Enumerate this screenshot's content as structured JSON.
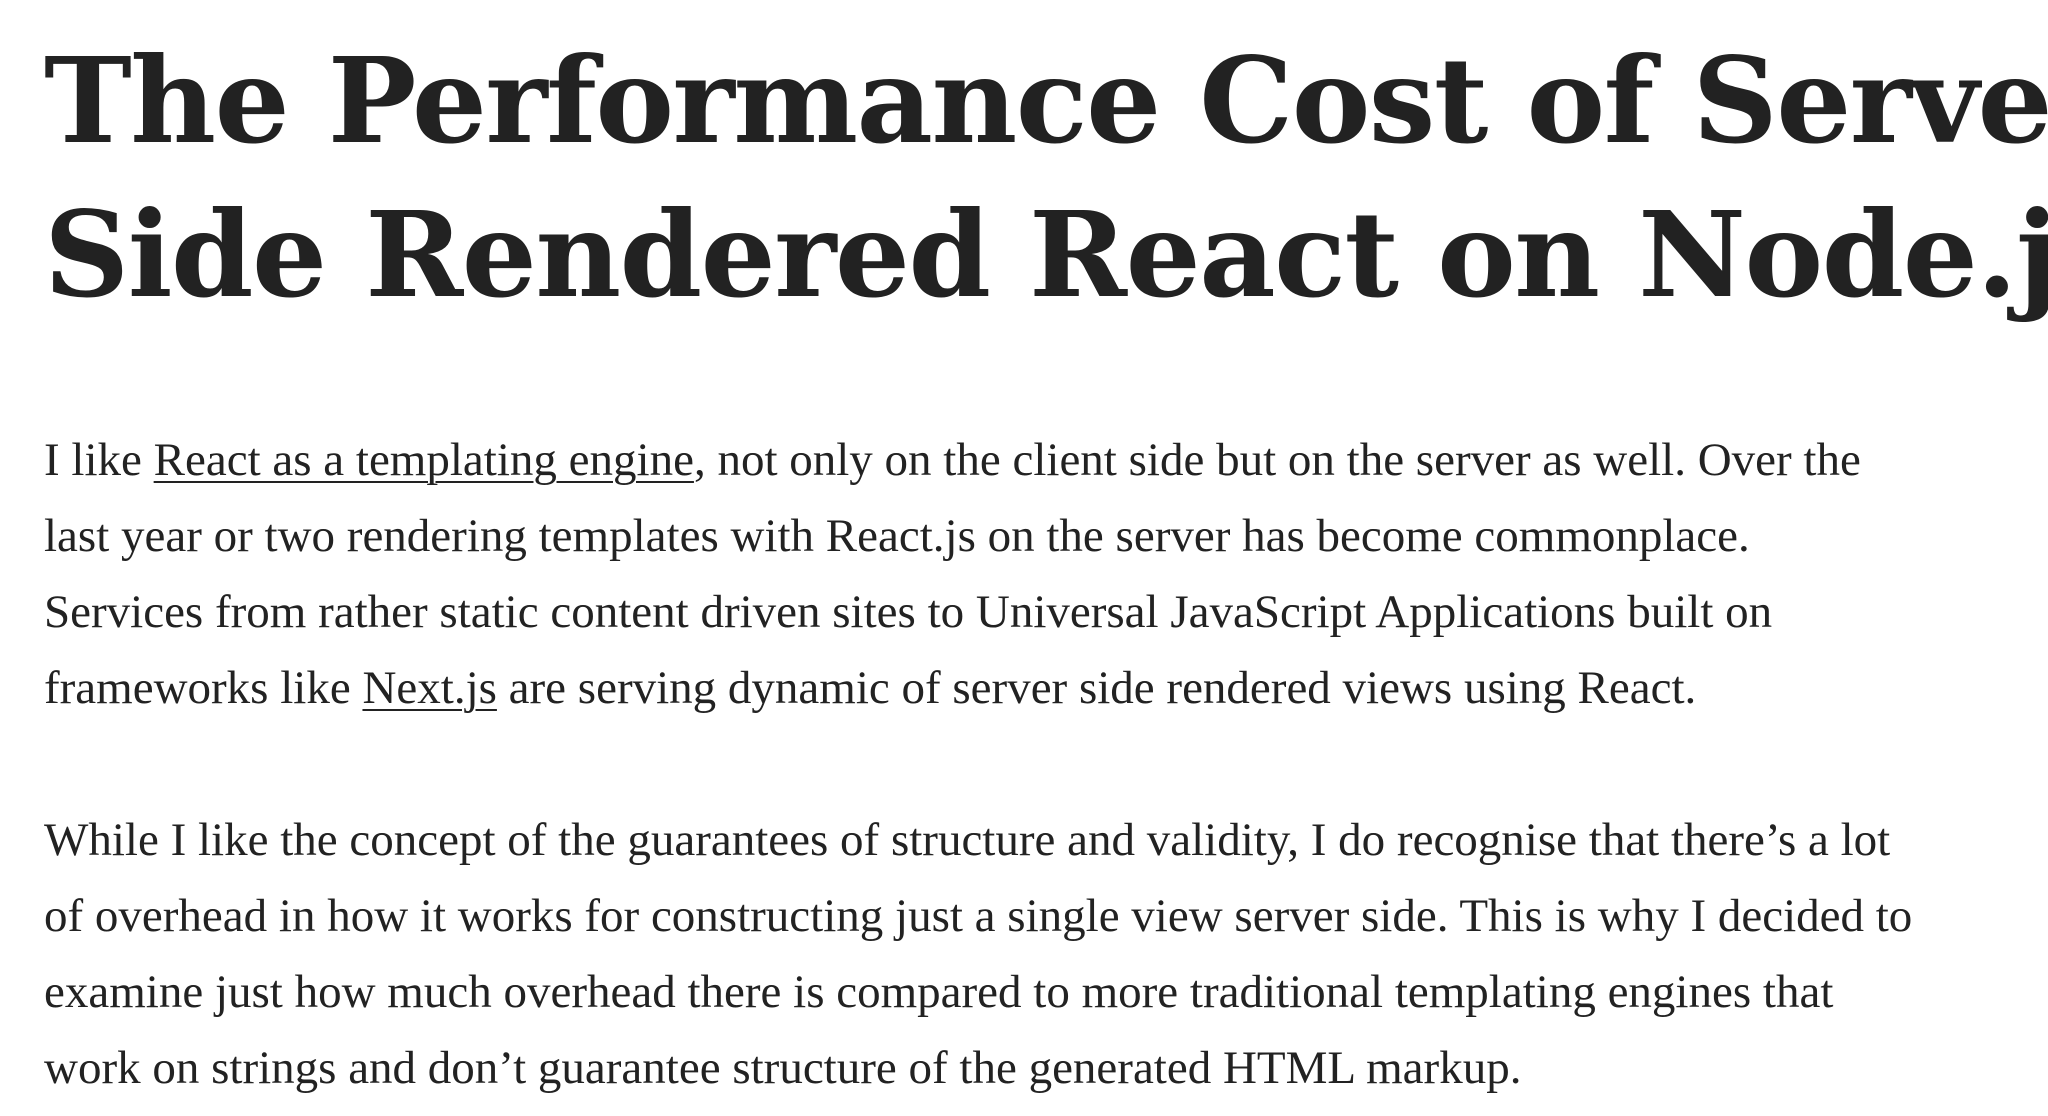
{
  "article": {
    "title": {
      "line1": "The Performance Cost of Server",
      "line2": "Side Rendered React on Node.js"
    },
    "paragraph1": {
      "l1_pre": "I like ",
      "l1_link": "React as a templating engine",
      "l1_post": ", not only on the client side but on the server as well. Over the",
      "l2": "last year or two rendering templates with React.js on the server has become commonplace.",
      "l3": "Services from rather static content driven sites to Universal JavaScript Applications built on",
      "l4_pre": "frameworks like ",
      "l4_link": "Next.js",
      "l4_post": " are serving dynamic of server side rendered views using React."
    },
    "paragraph2": {
      "l1": "While I like the concept of the guarantees of structure and validity, I do recognise that there’s a lot",
      "l2": "of overhead in how it works for constructing just a single view server side. This is why I decided to",
      "l3": "examine just how much overhead there is compared to more traditional templating engines that",
      "l4": "work on strings and don’t guarantee structure of the generated HTML markup."
    }
  }
}
